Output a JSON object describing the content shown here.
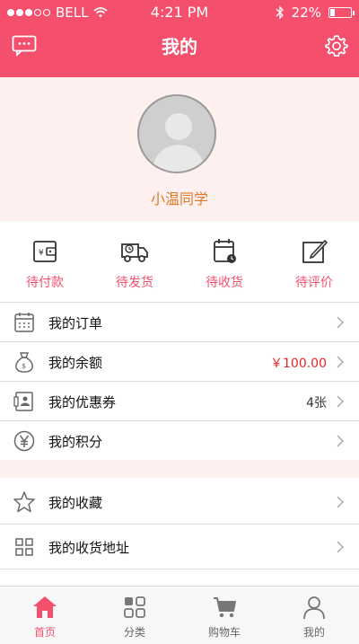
{
  "status_bar": {
    "carrier": "BELL",
    "time": "4:21 PM",
    "battery": "22%",
    "battery_level": 0.22
  },
  "header": {
    "title": "我的",
    "left_icon": "message-icon",
    "right_icon": "gear-icon"
  },
  "profile": {
    "username": "小温同学"
  },
  "order_status": [
    {
      "label": "待付款",
      "icon": "wallet-icon"
    },
    {
      "label": "待发货",
      "icon": "truck-icon"
    },
    {
      "label": "待收货",
      "icon": "calendar-clock-icon"
    },
    {
      "label": "待评价",
      "icon": "edit-icon"
    }
  ],
  "menu": [
    {
      "label": "我的订单",
      "value": "",
      "icon": "calendar-icon"
    },
    {
      "label": "我的余额",
      "value": "￥100.00",
      "icon": "money-bag-icon"
    },
    {
      "label": "我的优惠券",
      "value": "4张",
      "icon": "coupon-icon"
    },
    {
      "label": "我的积分",
      "value": "",
      "icon": "yen-icon"
    },
    {
      "label": "我的收藏",
      "value": "",
      "icon": "star-icon"
    },
    {
      "label": "我的收货地址",
      "value": "",
      "icon": "grid-icon"
    }
  ],
  "tabs": [
    {
      "label": "首页",
      "icon": "home-icon",
      "active": true
    },
    {
      "label": "分类",
      "icon": "category-icon",
      "active": false
    },
    {
      "label": "购物车",
      "icon": "cart-icon",
      "active": false
    },
    {
      "label": "我的",
      "icon": "user-icon",
      "active": false
    }
  ],
  "colors": {
    "accent": "#f4506e",
    "username": "#e07a2a",
    "balance": "#e8262c",
    "profile_bg": "#fdf0ee"
  }
}
